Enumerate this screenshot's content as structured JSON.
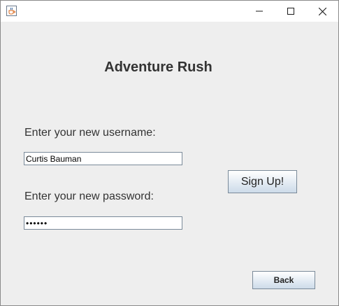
{
  "window": {
    "app_icon": "java-coffee-cup-icon",
    "controls": [
      "minimize-icon",
      "maximize-icon",
      "close-icon"
    ]
  },
  "main": {
    "title": "Adventure Rush",
    "username_label": "Enter your new username:",
    "username_value": "Curtis Bauman",
    "password_label": "Enter your new password:",
    "password_value": "••••••",
    "signup_label": "Sign Up!",
    "back_label": "Back"
  },
  "colors": {
    "background": "#eeeeee",
    "titlebar": "#ffffff",
    "text": "#333333",
    "button_border": "#7a8a99"
  }
}
